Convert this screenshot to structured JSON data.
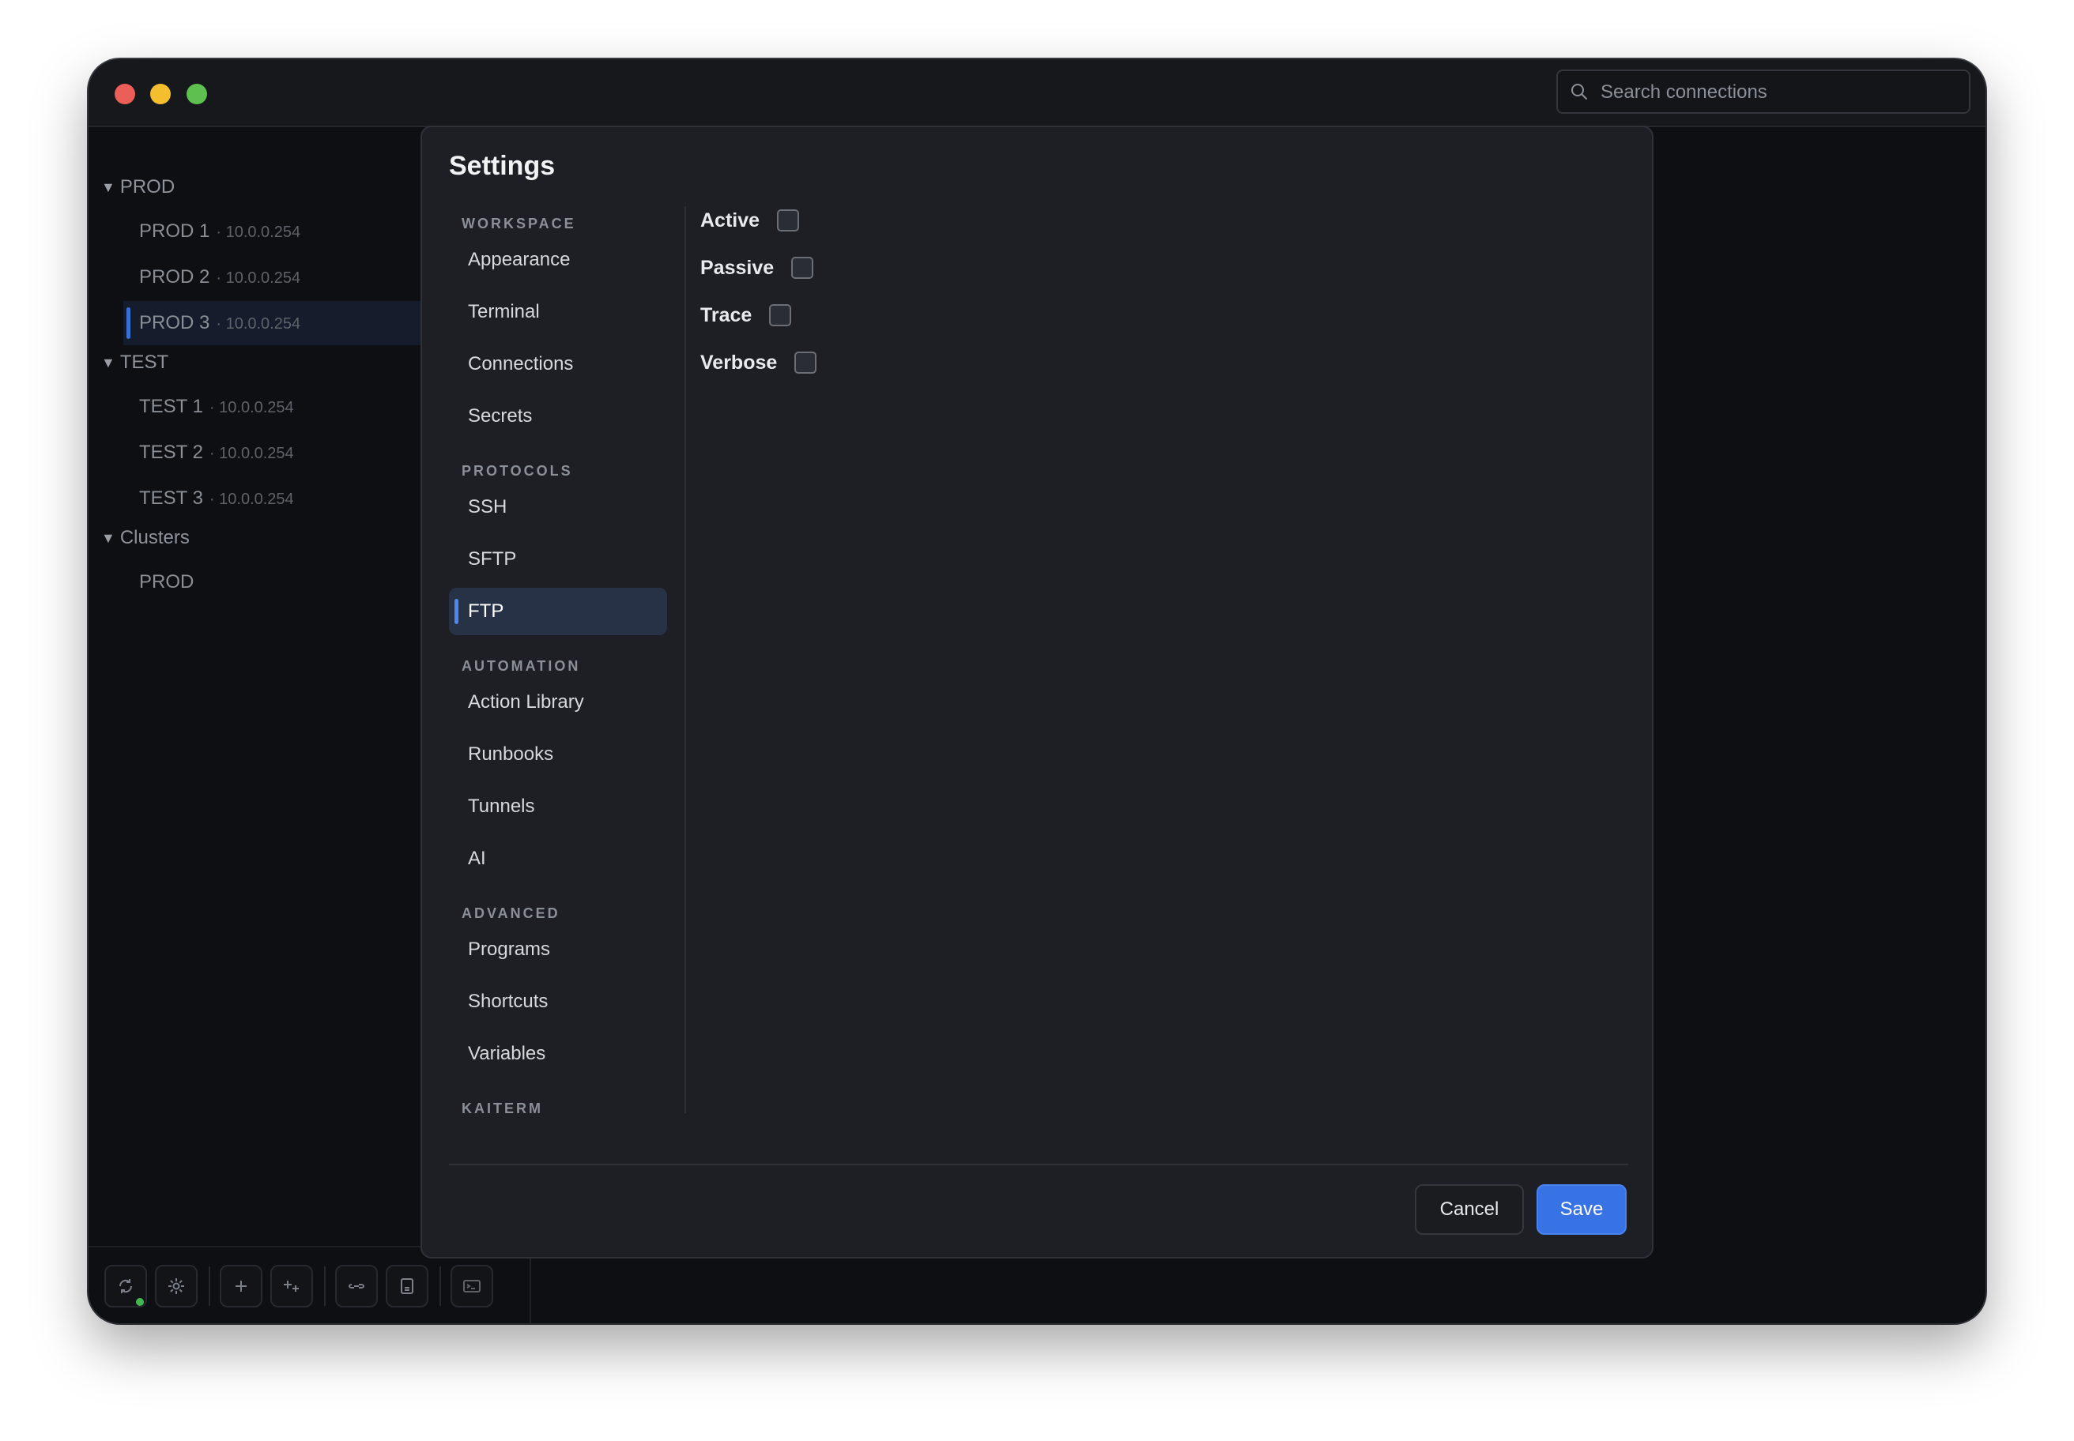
{
  "search": {
    "placeholder": "Search connections"
  },
  "sidebar": {
    "groups": [
      {
        "label": "PROD",
        "items": [
          {
            "name": "PROD 1",
            "address": "· 10.0.0.254"
          },
          {
            "name": "PROD 2",
            "address": "· 10.0.0.254"
          },
          {
            "name": "PROD 3",
            "address": "· 10.0.0.254",
            "selected": true
          }
        ]
      },
      {
        "label": "TEST",
        "items": [
          {
            "name": "TEST 1",
            "address": "· 10.0.0.254"
          },
          {
            "name": "TEST 2",
            "address": "· 10.0.0.254"
          },
          {
            "name": "TEST 3",
            "address": "· 10.0.0.254"
          }
        ]
      },
      {
        "label": "Clusters",
        "items": [
          {
            "name": "PROD",
            "address": ""
          }
        ]
      }
    ]
  },
  "toolbar": {
    "icons": [
      "sync-icon",
      "gear-icon",
      "plus-icon",
      "add-multiple-icon",
      "link-icon",
      "document-icon",
      "terminal-icon"
    ],
    "status": "connected"
  },
  "settings": {
    "title": "Settings",
    "sections": [
      {
        "heading": "WORKSPACE",
        "items": [
          "Appearance",
          "Terminal",
          "Connections",
          "Secrets"
        ]
      },
      {
        "heading": "PROTOCOLS",
        "items": [
          "SSH",
          "SFTP",
          "FTP"
        ]
      },
      {
        "heading": "AUTOMATION",
        "items": [
          "Action Library",
          "Runbooks",
          "Tunnels",
          "AI"
        ]
      },
      {
        "heading": "ADVANCED",
        "items": [
          "Programs",
          "Shortcuts",
          "Variables"
        ]
      },
      {
        "heading": "KAITERM",
        "items": []
      }
    ],
    "active_item": "FTP",
    "options": [
      {
        "label": "Active",
        "checked": false
      },
      {
        "label": "Passive",
        "checked": false
      },
      {
        "label": "Trace",
        "checked": false
      },
      {
        "label": "Verbose",
        "checked": false
      }
    ],
    "cancel_label": "Cancel",
    "save_label": "Save"
  },
  "colors": {
    "accent": "#3873e6",
    "background": "#0d0f12",
    "modal": "#1d1f24"
  }
}
